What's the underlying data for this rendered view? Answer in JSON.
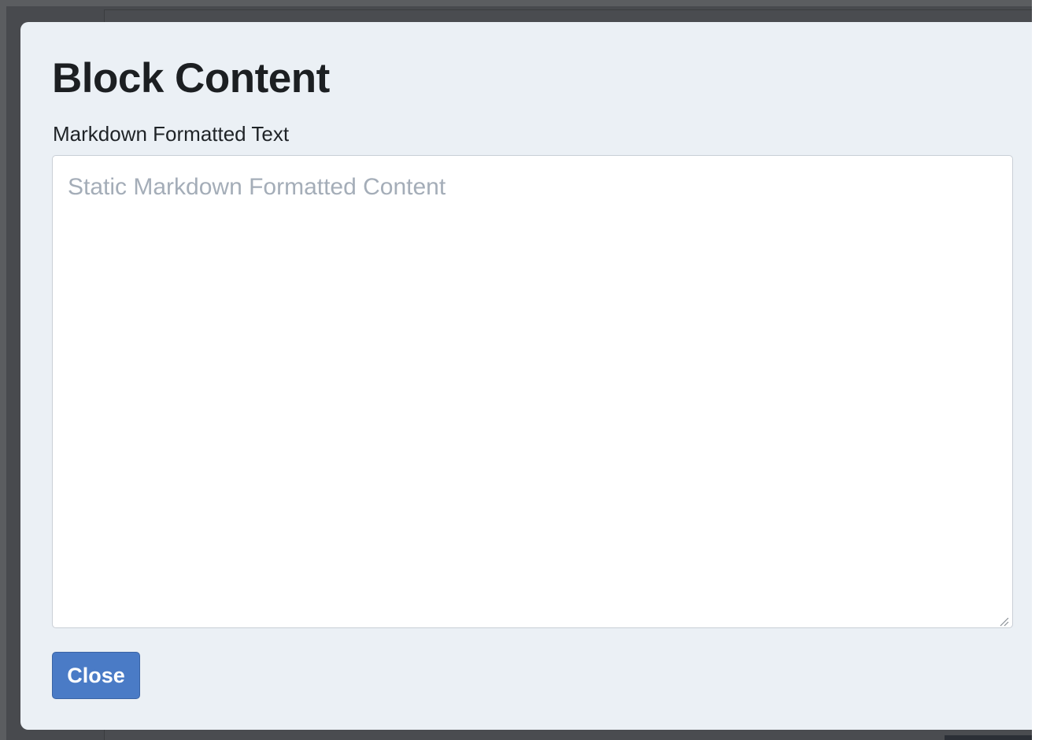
{
  "modal": {
    "title": "Block Content",
    "field_label": "Markdown Formatted Text",
    "textarea": {
      "value": "",
      "placeholder": "Static Markdown Formatted Content"
    },
    "close_label": "Close"
  },
  "colors": {
    "modal_background": "#ebf0f5",
    "primary_button": "#4a7bc6",
    "placeholder_text": "#a4adb8",
    "backdrop": "#4a4c50"
  },
  "icons": {
    "resize_handle": "resize-grip-icon"
  }
}
